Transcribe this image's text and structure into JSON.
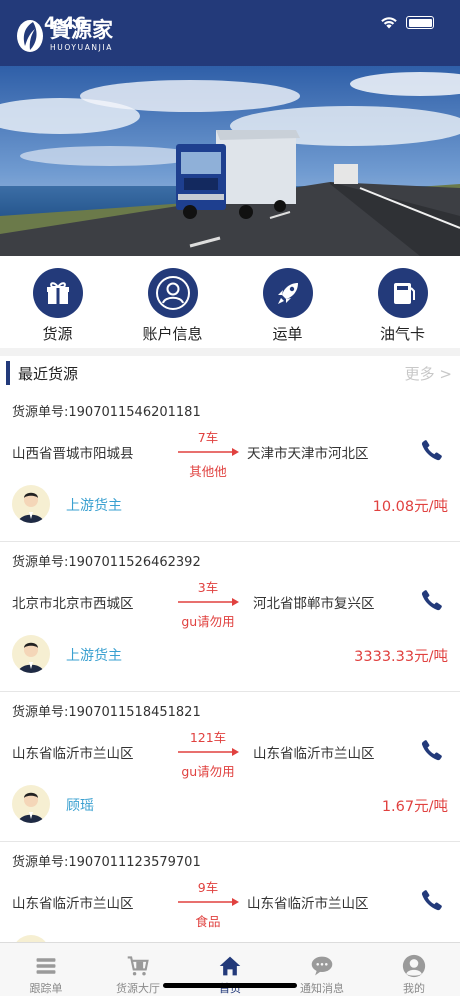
{
  "status": {
    "time": "4:46"
  },
  "brand": {
    "name_cn": "貨源家",
    "name_en": "HUOYUANJIA",
    "primary_color": "#233a7a"
  },
  "quick_menu": [
    {
      "label": "货源",
      "icon": "gift-icon"
    },
    {
      "label": "账户信息",
      "icon": "user-icon"
    },
    {
      "label": "运单",
      "icon": "rocket-icon"
    },
    {
      "label": "油气卡",
      "icon": "fuel-card-icon"
    }
  ],
  "section": {
    "title": "最近货源",
    "more": "更多 >"
  },
  "cargo": [
    {
      "no": "货源单号:1907011546201181",
      "from": "山西省晋城市阳城县",
      "trucks": "7车",
      "goods": "其他他",
      "to": "天津市天津市河北区",
      "owner": "上游货主",
      "price": "10.08元/吨"
    },
    {
      "no": "货源单号:1907011526462392",
      "from": "北京市北京市西城区",
      "trucks": "3车",
      "goods": "gu请勿用",
      "to": "河北省邯郸市复兴区",
      "owner": "上游货主",
      "price": "3333.33元/吨"
    },
    {
      "no": "货源单号:1907011518451821",
      "from": "山东省临沂市兰山区",
      "trucks": "121车",
      "goods": "gu请勿用",
      "to": "山东省临沂市兰山区",
      "owner": "顾瑶",
      "price": "1.67元/吨"
    },
    {
      "no": "货源单号:1907011123579701",
      "from": "山东省临沂市兰山区",
      "trucks": "9车",
      "goods": "食品",
      "to": "山东省临沂市兰山区",
      "owner": "",
      "price": ""
    }
  ],
  "tabs": [
    {
      "label": "跟踪单",
      "icon": "list-icon",
      "active": false
    },
    {
      "label": "货源大厅",
      "icon": "cart-icon",
      "active": false
    },
    {
      "label": "首页",
      "icon": "home-icon",
      "active": true
    },
    {
      "label": "通知消息",
      "icon": "chat-icon",
      "active": false
    },
    {
      "label": "我的",
      "icon": "profile-icon",
      "active": false
    }
  ]
}
